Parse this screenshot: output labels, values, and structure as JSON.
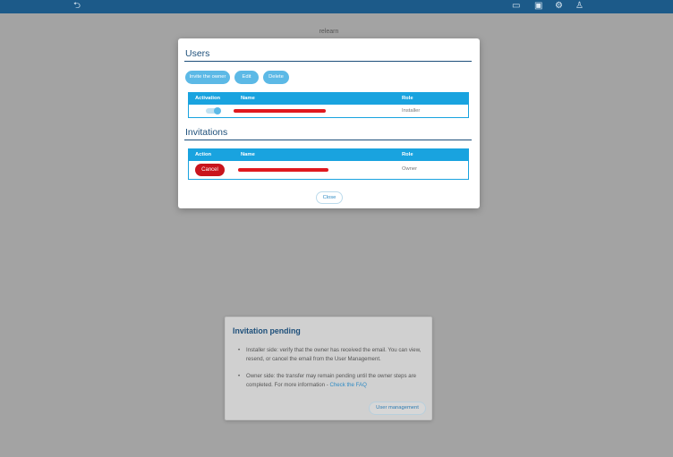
{
  "topbar": {
    "icons": [
      "back-icon",
      "chat-icon",
      "screen-icon",
      "gear-icon",
      "user-icon"
    ],
    "glyphs": {
      "back": "⮌",
      "chat": "▭",
      "screen": "▣",
      "gear": "⚙",
      "user": "♙"
    }
  },
  "background": {
    "title": "relearn"
  },
  "modal": {
    "users": {
      "title": "Users",
      "buttons": {
        "invite": "Invite the owner",
        "edit": "Edit",
        "delete": "Delete"
      },
      "columns": {
        "activation": "Activation",
        "name": "Name",
        "role": "Role"
      },
      "rows": [
        {
          "activation": true,
          "name_redacted": true,
          "role": "Installer"
        }
      ]
    },
    "invitations": {
      "title": "Invitations",
      "columns": {
        "action": "Action",
        "name": "Name",
        "role": "Role"
      },
      "rows": [
        {
          "action_label": "Cancel",
          "name_redacted": true,
          "role": "Owner"
        }
      ]
    },
    "close_label": "Close"
  },
  "info_panel": {
    "title": "Invitation pending",
    "bullet1": "Installer side: verify that the owner has received the email. You can view, resend, or cancel the email from the User Management.",
    "bullet2": "Owner side: the transfer may remain pending until the owner steps are completed. For more information -",
    "faq_link": "Check the FAQ",
    "button": "User management"
  },
  "colors": {
    "topbar": "#1c5a89",
    "accent": "#19a3df",
    "button_light": "#5cb9e6",
    "danger": "#c9141d",
    "redaction": "#e0191f",
    "heading": "#1d4f7a"
  }
}
